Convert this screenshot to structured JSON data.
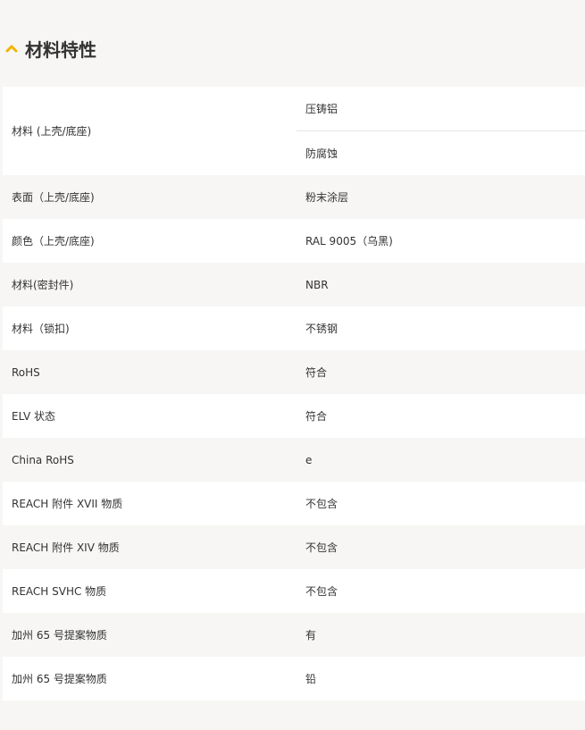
{
  "section": {
    "title": "材料特性",
    "icon": "chevron-up-icon",
    "accent": "#f0b400"
  },
  "rows": [
    {
      "key": "材料 (上壳/底座)",
      "values": [
        "压铸铝",
        "防腐蚀"
      ]
    },
    {
      "key": "表面（上壳/底座)",
      "values": [
        "粉末涂层"
      ]
    },
    {
      "key": "颜色（上壳/底座)",
      "values": [
        "RAL 9005（乌黑)"
      ]
    },
    {
      "key": "材料(密封件)",
      "values": [
        "NBR"
      ]
    },
    {
      "key": "材料（锁扣)",
      "values": [
        "不锈钢"
      ]
    },
    {
      "key": "RoHS",
      "values": [
        "符合"
      ]
    },
    {
      "key": "ELV 状态",
      "values": [
        "符合"
      ]
    },
    {
      "key": "China RoHS",
      "values": [
        "e"
      ]
    },
    {
      "key": "REACH 附件 XVII 物质",
      "values": [
        "不包含"
      ]
    },
    {
      "key": "REACH 附件 XIV 物质",
      "values": [
        "不包含"
      ]
    },
    {
      "key": "REACH SVHC 物质",
      "values": [
        "不包含"
      ]
    },
    {
      "key": "加州 65 号提案物质",
      "values": [
        "有"
      ]
    },
    {
      "key": "加州 65 号提案物质",
      "values": [
        "铅"
      ]
    }
  ]
}
